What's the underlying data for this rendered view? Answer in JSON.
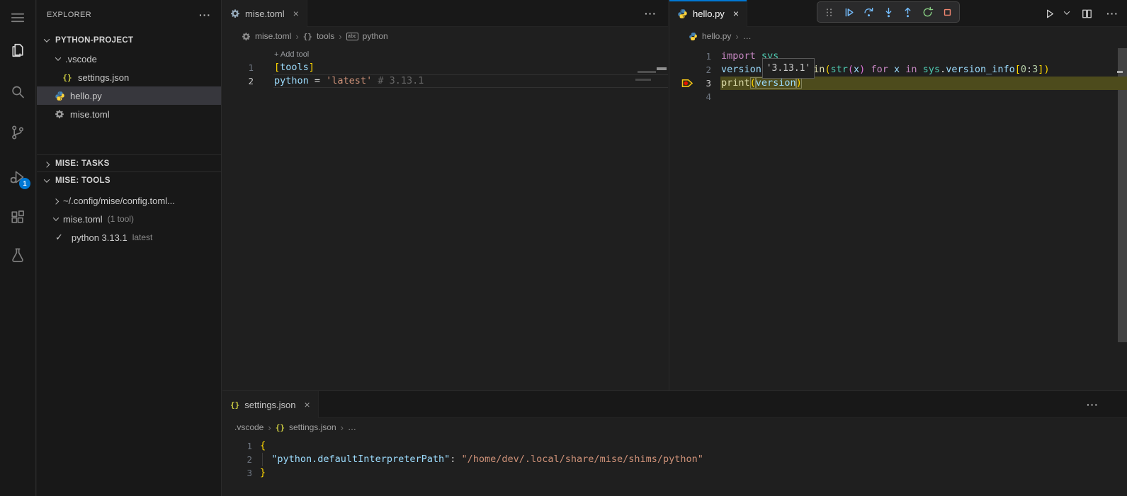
{
  "colors": {
    "accent": "#0078d4",
    "badge_bg": "#0078d4",
    "debug_line_bg": "#4d4b1c",
    "breakpoint_outline": "#f5c518",
    "breakpoint_dot": "#e51400",
    "debug_blue": "#75beff",
    "restart_green": "#89d185",
    "stop_red": "#f48771"
  },
  "glyphs": {
    "close": "×",
    "more": "···",
    "ellipsis": "…",
    "sep": "›",
    "plus": "+",
    "check": "✓",
    "abc": "abc"
  },
  "activity_bar": {
    "icons": [
      "menu",
      "explorer",
      "search",
      "source-control",
      "run-and-debug",
      "extensions",
      "testing"
    ],
    "active": "explorer",
    "debug_badge": "1"
  },
  "explorer": {
    "title": "EXPLORER",
    "root_label": "PYTHON-PROJECT",
    "rows": [
      {
        "label": ".vscode"
      },
      {
        "label": "settings.json"
      },
      {
        "label": "hello.py"
      },
      {
        "label": "mise.toml"
      }
    ],
    "sections": [
      {
        "label": "MISE: TASKS"
      },
      {
        "label": "MISE: TOOLS"
      }
    ],
    "tools_rows": [
      {
        "label": "~/.config/mise/config.toml..."
      },
      {
        "label": "mise.toml",
        "suffix": "(1 tool)"
      },
      {
        "label": "python 3.13.1",
        "suffix": "latest"
      }
    ]
  },
  "editor_mise": {
    "tab": "mise.toml",
    "breadcrumb": {
      "file": "mise.toml",
      "section": "tools",
      "symbol": "python"
    },
    "codelens_label": "Add tool",
    "lines": [
      {
        "n": "1",
        "tokens": [
          {
            "t": "[",
            "c": "b1"
          },
          {
            "t": "tools",
            "c": "var"
          },
          {
            "t": "]",
            "c": "b1"
          }
        ]
      },
      {
        "n": "2",
        "tokens": [
          {
            "t": "python",
            "c": "var"
          },
          {
            "t": " = ",
            "c": "txt"
          },
          {
            "t": "'latest'",
            "c": "str"
          },
          {
            "t": " ",
            "c": "txt"
          },
          {
            "t": "# 3.13.1",
            "c": "ghost"
          }
        ]
      }
    ]
  },
  "editor_hello": {
    "tab": "hello.py",
    "breadcrumb": {
      "file": "hello.py"
    },
    "hover_value": "'3.13.1'",
    "lines": [
      {
        "n": "1",
        "tokens": [
          {
            "t": "import",
            "c": "kw"
          },
          {
            "t": " ",
            "c": "txt"
          },
          {
            "t": "sys",
            "c": "mod"
          }
        ]
      },
      {
        "n": "2",
        "tokens": [
          {
            "t": "version",
            "c": "var"
          },
          {
            "t": " = ",
            "c": "txt"
          },
          {
            "t": "'.'",
            "c": "str"
          },
          {
            "t": ".",
            "c": "txt"
          },
          {
            "t": "join",
            "c": "fn"
          },
          {
            "t": "(",
            "c": "b1"
          },
          {
            "t": "str",
            "c": "mod"
          },
          {
            "t": "(",
            "c": "b2"
          },
          {
            "t": "x",
            "c": "var"
          },
          {
            "t": ")",
            "c": "b2"
          },
          {
            "t": " ",
            "c": "txt"
          },
          {
            "t": "for",
            "c": "kw"
          },
          {
            "t": " ",
            "c": "txt"
          },
          {
            "t": "x",
            "c": "var"
          },
          {
            "t": " ",
            "c": "txt"
          },
          {
            "t": "in",
            "c": "kw"
          },
          {
            "t": " ",
            "c": "txt"
          },
          {
            "t": "sys",
            "c": "mod"
          },
          {
            "t": ".",
            "c": "txt"
          },
          {
            "t": "version_info",
            "c": "var"
          },
          {
            "t": "[",
            "c": "b1"
          },
          {
            "t": "0",
            "c": "num"
          },
          {
            "t": ":",
            "c": "txt"
          },
          {
            "t": "3",
            "c": "num"
          },
          {
            "t": "]",
            "c": "b1"
          },
          {
            "t": ")",
            "c": "b1"
          }
        ]
      },
      {
        "n": "3",
        "tokens": [
          {
            "t": "print",
            "c": "fn"
          },
          {
            "t": "(",
            "c": "b1",
            "m": 1
          },
          {
            "t": "version",
            "c": "var",
            "m": 1
          },
          {
            "t": ")",
            "c": "b1",
            "m": 1
          }
        ]
      },
      {
        "n": "4",
        "tokens": []
      }
    ]
  },
  "debug_toolbar": {
    "icons": [
      "gripper",
      "continue",
      "step-over",
      "step-into",
      "step-out",
      "restart",
      "stop"
    ]
  },
  "panel_settings": {
    "tab": "settings.json",
    "breadcrumb": {
      "folder": ".vscode",
      "file": "settings.json"
    },
    "lines": [
      {
        "n": "1",
        "tokens": [
          {
            "t": "{",
            "c": "b1"
          }
        ]
      },
      {
        "n": "2",
        "tokens": [
          {
            "t": "  ",
            "c": "txt"
          },
          {
            "t": "\"python.defaultInterpreterPath\"",
            "c": "var"
          },
          {
            "t": ": ",
            "c": "txt"
          },
          {
            "t": "\"/home/dev/.local/share/mise/shims/python\"",
            "c": "str"
          }
        ]
      },
      {
        "n": "3",
        "tokens": [
          {
            "t": "}",
            "c": "b1"
          }
        ]
      }
    ]
  }
}
